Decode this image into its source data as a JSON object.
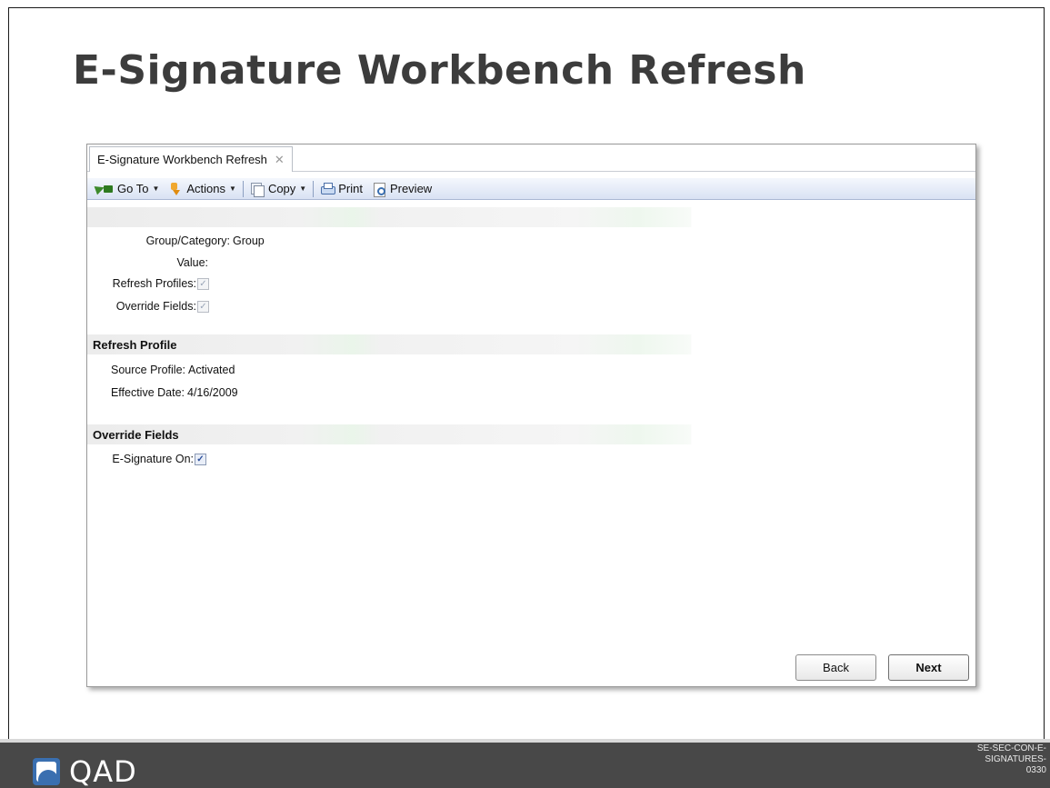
{
  "slide": {
    "title": "E-Signature Workbench Refresh",
    "logo_text": "QAD",
    "doc_code_lines": [
      "SE-SEC-CON-E-",
      "SIGNATURES-",
      "0330"
    ]
  },
  "window": {
    "tab_label": "E-Signature Workbench Refresh",
    "tab_close_glyph": "✕"
  },
  "toolbar": {
    "goto_label": "Go To",
    "actions_label": "Actions",
    "copy_label": "Copy",
    "print_label": "Print",
    "preview_label": "Preview",
    "caret": "▼"
  },
  "form": {
    "group_category": {
      "label": "Group/Category:",
      "value": "Group"
    },
    "value_field": {
      "label": "Value:",
      "value": ""
    },
    "refresh_profiles": {
      "label": "Refresh Profiles:",
      "checked": true,
      "enabled": false
    },
    "override_fields_cb": {
      "label": "Override Fields:",
      "checked": true,
      "enabled": false
    },
    "refresh_profile_section": {
      "title": "Refresh Profile",
      "source_profile": {
        "label": "Source Profile:",
        "value": "Activated"
      },
      "effective_date": {
        "label": "Effective Date:",
        "value": "4/16/2009"
      }
    },
    "override_fields_section": {
      "title": "Override Fields",
      "esignature_on": {
        "label": "E-Signature On:",
        "checked": true,
        "enabled": true
      }
    }
  },
  "buttons": {
    "back_label": "Back",
    "next_label": "Next"
  },
  "icons": [
    "goto-icon",
    "actions-icon",
    "copy-icon",
    "print-icon",
    "preview-icon",
    "close-icon",
    "qad-logo-icon"
  ],
  "check_glyph": "✓"
}
